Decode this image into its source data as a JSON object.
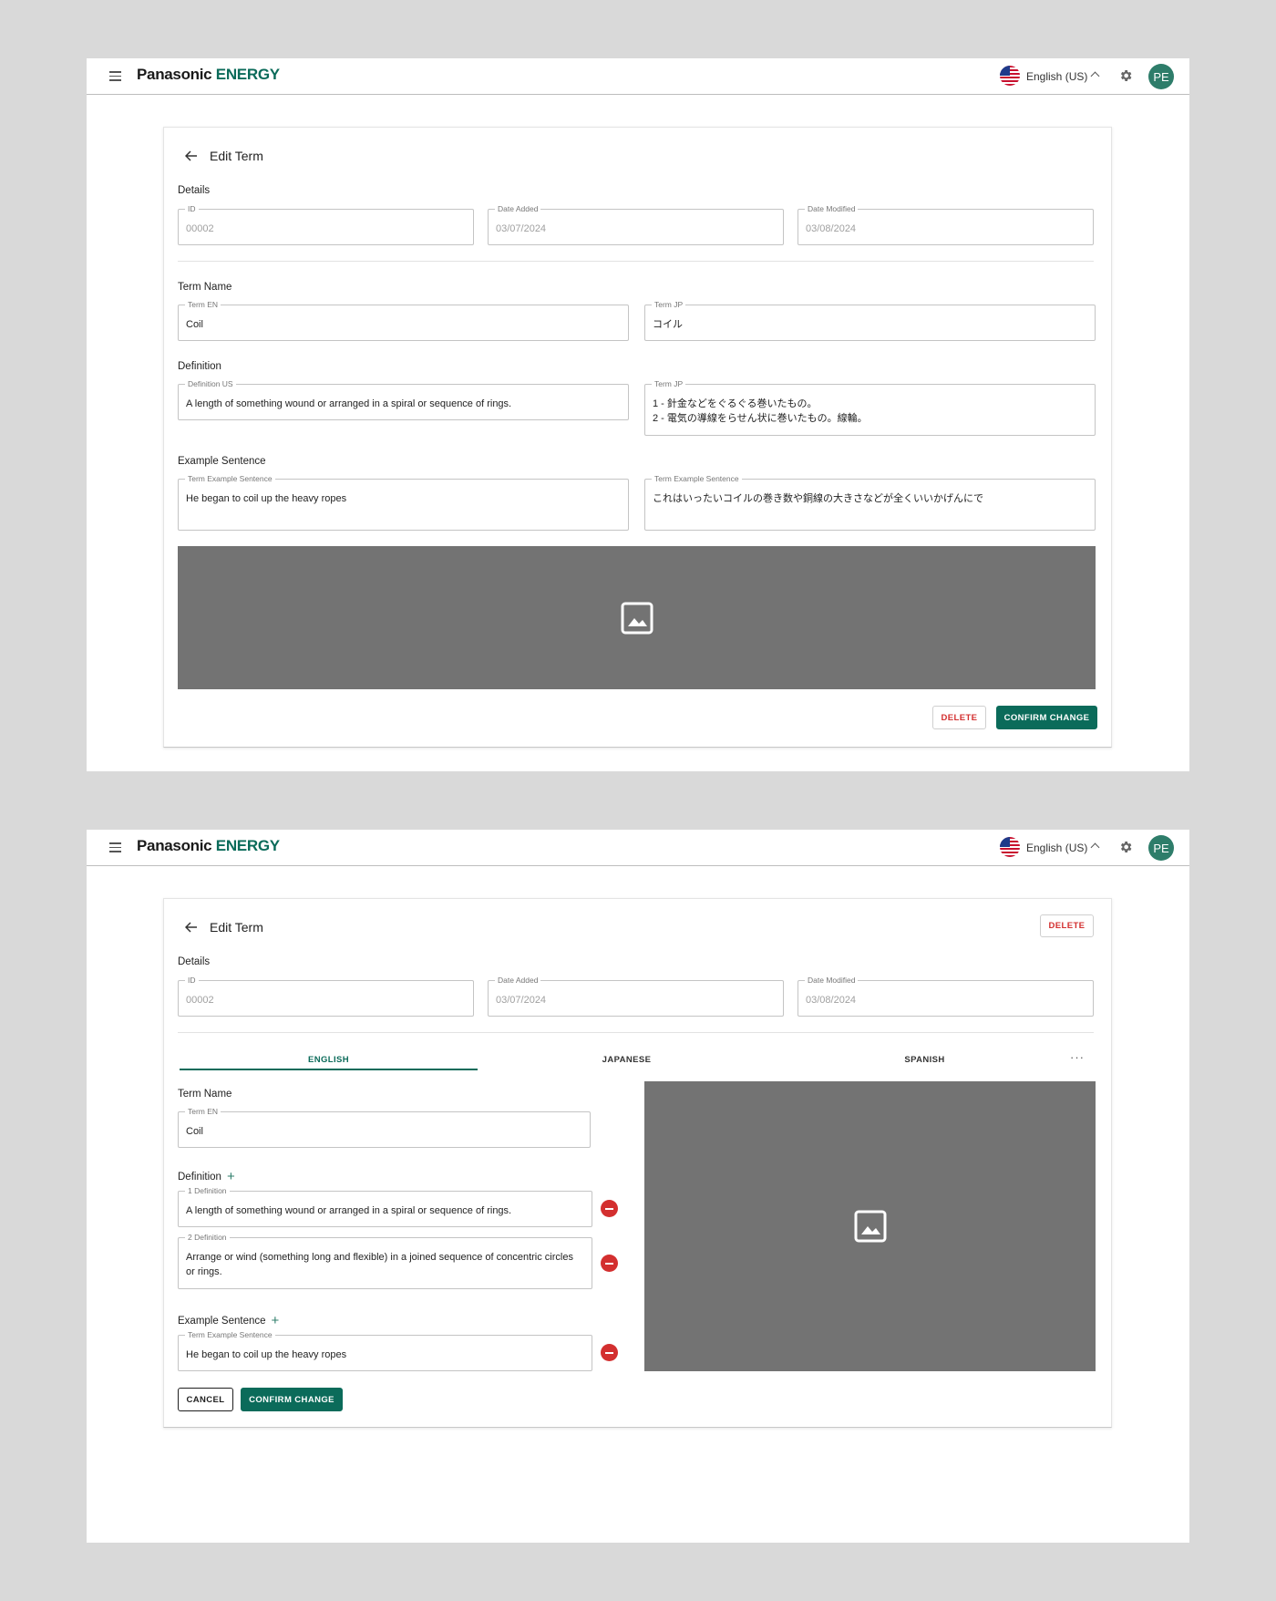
{
  "app": {
    "brand": "Panasonic",
    "brand_suffix": "ENERGY",
    "language": "English (US)",
    "avatar_initials": "PE"
  },
  "screen1": {
    "title": "Edit Term",
    "details": {
      "label": "Details",
      "id_label": "ID",
      "id_value": "00002",
      "date_added_label": "Date Added",
      "date_added_value": "03/07/2024",
      "date_modified_label": "Date Modified",
      "date_modified_value": "03/08/2024"
    },
    "term_name": {
      "label": "Term Name",
      "en_label": "Term EN",
      "en_value": "Coil",
      "jp_label": "Term JP",
      "jp_value": "コイル"
    },
    "definition": {
      "label": "Definition",
      "us_label": "Definition US",
      "us_value": "A length of something wound or arranged in a spiral or sequence of rings.",
      "jp_label": "Term JP",
      "jp_line1": "1 - 針金などをぐるぐる巻いたもの。",
      "jp_line2": "2 - 電気の導線をらせん状に巻いたもの。線輪。"
    },
    "example": {
      "label": "Example Sentence",
      "en_label": "Term Example Sentence",
      "en_value": "He began to coil up the heavy ropes",
      "jp_label": "Term Example Sentence",
      "jp_value": "これはいったいコイルの巻き数や銅線の大きさなどが全くいいかげんにで"
    },
    "delete_label": "DELETE",
    "confirm_label": "CONFIRM CHANGE"
  },
  "screen2": {
    "title": "Edit Term",
    "delete_label": "DELETE",
    "details": {
      "label": "Details",
      "id_label": "ID",
      "id_value": "00002",
      "date_added_label": "Date Added",
      "date_added_value": "03/07/2024",
      "date_modified_label": "Date Modified",
      "date_modified_value": "03/08/2024"
    },
    "tabs": [
      "ENGLISH",
      "JAPANESE",
      "SPANISH"
    ],
    "active_tab": "ENGLISH",
    "more": "···",
    "term_name": {
      "label": "Term Name",
      "en_label": "Term EN",
      "en_value": "Coil"
    },
    "definition": {
      "label": "Definition",
      "items": [
        {
          "label": "1 Definition",
          "value": "A length of something wound or arranged in a spiral or sequence of rings."
        },
        {
          "label": "2 Definition",
          "value": "Arrange or wind (something long and flexible) in a joined sequence of concentric circles or rings."
        }
      ]
    },
    "example": {
      "label": "Example Sentence",
      "items": [
        {
          "label": "Term Example Sentence",
          "value": "He began to coil up the heavy ropes"
        }
      ]
    },
    "cancel_label": "CANCEL",
    "confirm_label": "CONFIRM CHANGE"
  },
  "colors": {
    "primary": "#0b6b5a",
    "danger": "#d32f2f",
    "placeholder": "#737373"
  }
}
